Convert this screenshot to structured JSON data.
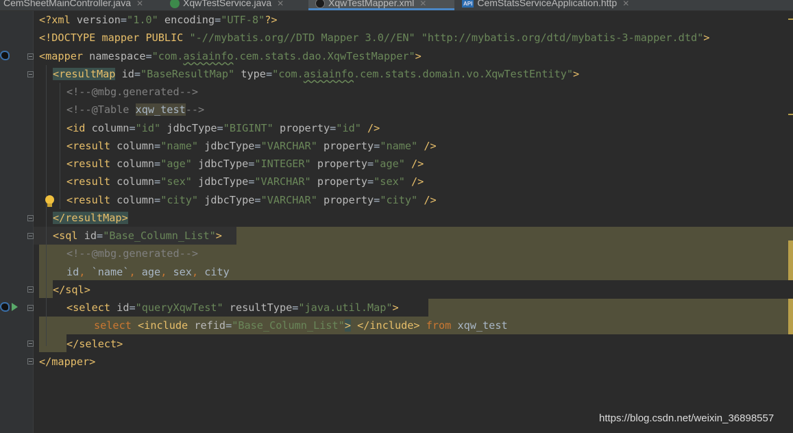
{
  "tabs": [
    {
      "label": "CemSheetMainController.java",
      "icon": "java-class-icon",
      "active": false
    },
    {
      "label": "XqwTestService.java",
      "icon": "java-interface-icon",
      "active": false
    },
    {
      "label": "XqwTestMapper.xml",
      "icon": "mybatis-xml-icon",
      "active": true
    },
    {
      "label": "CemStatsServiceApplication.http",
      "icon": "api-http-icon",
      "active": false
    }
  ],
  "editor": {
    "xml_decl": {
      "open": "<?xml",
      "version_attr": "version",
      "version_val": "\"1.0\"",
      "encoding_attr": "encoding",
      "encoding_val": "\"UTF-8\"",
      "close": "?>"
    },
    "doctype": {
      "keyword": "<!DOCTYPE",
      "rest": " mapper PUBLIC ",
      "public_id": "\"-//mybatis.org//DTD Mapper 3.0//EN\"",
      "system_id": "\"http://mybatis.org/dtd/mybatis-3-mapper.dtd\"",
      "close": ">"
    },
    "mapper_open": {
      "tag": "<mapper",
      "attr": "namespace",
      "val_pre": "\"com.",
      "val_ul": "asiainfo",
      "val_post": ".cem.stats.dao.XqwTestMapper\"",
      "close": ">"
    },
    "resultmap_open": {
      "tag": "<resultMap",
      "id_attr": "id",
      "id_val": "\"BaseResultMap\"",
      "type_attr": "type",
      "type_val_pre": "\"com.",
      "type_val_ul": "asiainfo",
      "type_val_post": ".cem.stats.domain.vo.XqwTestEntity\"",
      "close": ">"
    },
    "comment_mbg_1": "<!--@mbg.generated-->",
    "comment_table": {
      "open": "<!--@Table ",
      "name": "xqw_test",
      "close": "-->"
    },
    "id_line": {
      "tag": "<id",
      "col_attr": "column",
      "col_val": "\"id\"",
      "jdbc_attr": "jdbcType",
      "jdbc_val": "\"BIGINT\"",
      "prop_attr": "property",
      "prop_val": "\"id\"",
      "close": "/>"
    },
    "results": [
      {
        "tag": "<result",
        "col_attr": "column",
        "col_val": "\"name\"",
        "jdbc_attr": "jdbcType",
        "jdbc_val": "\"VARCHAR\"",
        "prop_attr": "property",
        "prop_val": "\"name\"",
        "close": "/>"
      },
      {
        "tag": "<result",
        "col_attr": "column",
        "col_val": "\"age\"",
        "jdbc_attr": "jdbcType",
        "jdbc_val": "\"INTEGER\"",
        "prop_attr": "property",
        "prop_val": "\"age\"",
        "close": "/>"
      },
      {
        "tag": "<result",
        "col_attr": "column",
        "col_val": "\"sex\"",
        "jdbc_attr": "jdbcType",
        "jdbc_val": "\"VARCHAR\"",
        "prop_attr": "property",
        "prop_val": "\"sex\"",
        "close": "/>"
      },
      {
        "tag": "<result",
        "col_attr": "column",
        "col_val": "\"city\"",
        "jdbc_attr": "jdbcType",
        "jdbc_val": "\"VARCHAR\"",
        "prop_attr": "property",
        "prop_val": "\"city\"",
        "close": "/>"
      }
    ],
    "resultmap_close": "</resultMap>",
    "sql_open": {
      "tag": "<sql",
      "attr": "id",
      "val": "\"Base_Column_List\"",
      "close": ">"
    },
    "comment_mbg_2": "<!--@mbg.generated-->",
    "columns": {
      "c1": "id",
      "sep1": ",",
      "c2": " `name`",
      "sep2": ",",
      "c3": " age",
      "sep3": ",",
      "c4": " sex",
      "sep4": ",",
      "c5": " city"
    },
    "sql_close": "</sql>",
    "select_open": {
      "tag": "<select",
      "id_attr": "id",
      "id_val": "\"queryXqwTest\"",
      "rt_attr": "resultType",
      "rt_val": "\"java.util.Map\"",
      "close": ">"
    },
    "select_body": {
      "kw_select": "select",
      "include_tag": "<include",
      "refid_attr": "refid",
      "refid_val": "\"Base_Column_List\"",
      "include_gt": ">",
      "include_close": "</include>",
      "kw_from": "from",
      "table": "xqw_test"
    },
    "select_close": "</select>",
    "mapper_close": "</mapper>"
  },
  "watermark": "https://blog.csdn.net/weixin_36898557",
  "colors": {
    "background": "#2b2b2b",
    "tag": "#e8bf6a",
    "attribute": "#bababa",
    "string": "#6a8759",
    "comment": "#808080",
    "keyword": "#cc7832",
    "injected_highlight": "#52503a"
  }
}
